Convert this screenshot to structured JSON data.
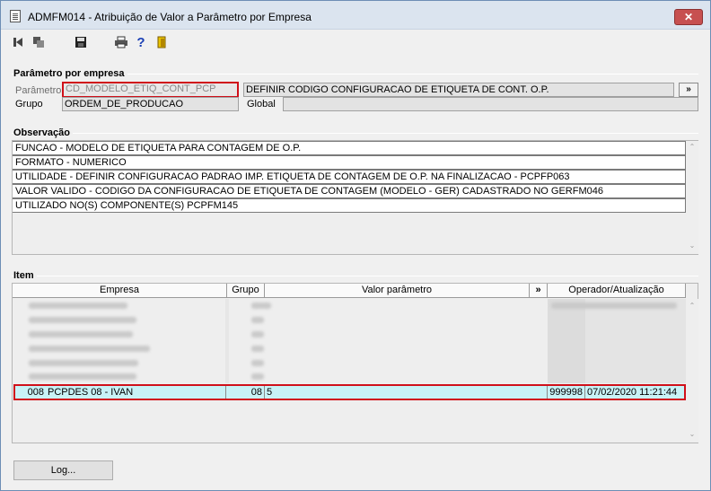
{
  "window": {
    "title": "ADMFM014 - Atribuição de Valor a Parâmetro por Empresa",
    "close_label": "✕"
  },
  "toolbar": {
    "buttons": [
      "first-icon",
      "copy-icon",
      "save-icon",
      "print-icon",
      "help-icon",
      "exit-door-icon"
    ]
  },
  "param_section": {
    "title": "Parâmetro por empresa",
    "param_label": "Parâmetro",
    "param_code": "CD_MODELO_ETIQ_CONT_PCP",
    "param_description": "DEFINIR CODIGO CONFIGURACAO DE ETIQUETA DE CONT. O.P.",
    "expand_label": "»",
    "group_label": "Grupo",
    "group_value": "ORDEM_DE_PRODUCAO",
    "global_label": "Global",
    "global_value": ""
  },
  "obs_section": {
    "title": "Observação",
    "lines": [
      "FUNCAO - MODELO DE ETIQUETA PARA CONTAGEM DE O.P.",
      "FORMATO - NUMERICO",
      "UTILIDADE - DEFINIR CONFIGURACAO PADRAO IMP. ETIQUETA DE CONTAGEM DE O.P. NA FINALIZACAO - PCPFP063",
      "VALOR VALIDO - CODIGO DA CONFIGURACAO DE ETIQUETA DE CONTAGEM (MODELO - GER) CADASTRADO NO GERFM046",
      "UTILIZADO NO(S) COMPONENTE(S) PCPFM145"
    ]
  },
  "item_section": {
    "title": "Item",
    "columns": {
      "empresa": "Empresa",
      "grupo": "Grupo",
      "valor": "Valor parâmetro",
      "expand": "»",
      "operador": "Operador/Atualização"
    },
    "selected_row": {
      "code": "008",
      "empresa": "PCPDES 08 - IVAN",
      "grupo": "08",
      "valor": "5",
      "operador": "999998",
      "atualizacao": "07/02/2020 11:21:44"
    }
  },
  "footer": {
    "log_label": "Log..."
  }
}
